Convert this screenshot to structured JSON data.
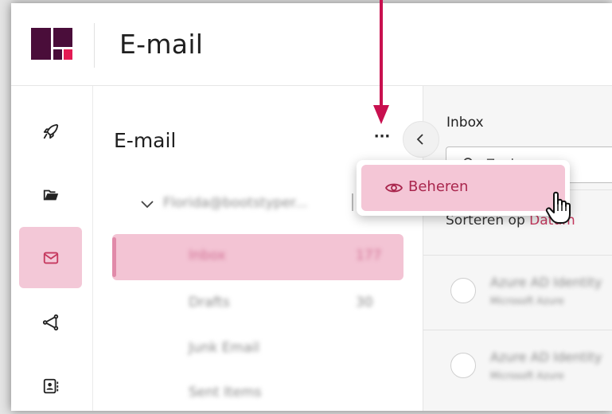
{
  "header": {
    "title": "E-mail"
  },
  "rail": {
    "items": [
      {
        "icon": "rocket-icon",
        "active": false
      },
      {
        "icon": "folder-icon",
        "active": false
      },
      {
        "icon": "mail-icon",
        "active": true
      },
      {
        "icon": "share-icon",
        "active": false
      },
      {
        "icon": "contact-card-icon",
        "active": false
      }
    ]
  },
  "folders": {
    "title": "E-mail",
    "more_label": "···",
    "account": "Florida@bootstyper...",
    "items": [
      {
        "name": "Inbox",
        "count": "177",
        "active": true
      },
      {
        "name": "Drafts",
        "count": "30",
        "active": false
      },
      {
        "name": "Junk Email",
        "count": "",
        "active": false
      },
      {
        "name": "Sent Items",
        "count": "",
        "active": false
      }
    ]
  },
  "list": {
    "title": "Inbox",
    "search_placeholder": "Zoeken",
    "sort_label": "Sorteren op",
    "sort_value": "Datum",
    "items": [
      {
        "sender": "Azure AD Identity",
        "preview": "Microsoft Azure"
      },
      {
        "sender": "Azure AD Identity",
        "preview": "Microsoft Azure"
      }
    ]
  },
  "dropdown": {
    "item_label": "Beheren",
    "item_icon": "eye-icon"
  },
  "colors": {
    "accent": "#c6395f",
    "active_bg": "#f3c8d7",
    "arrow": "#c8104f",
    "logo": "#4a0d3a"
  }
}
